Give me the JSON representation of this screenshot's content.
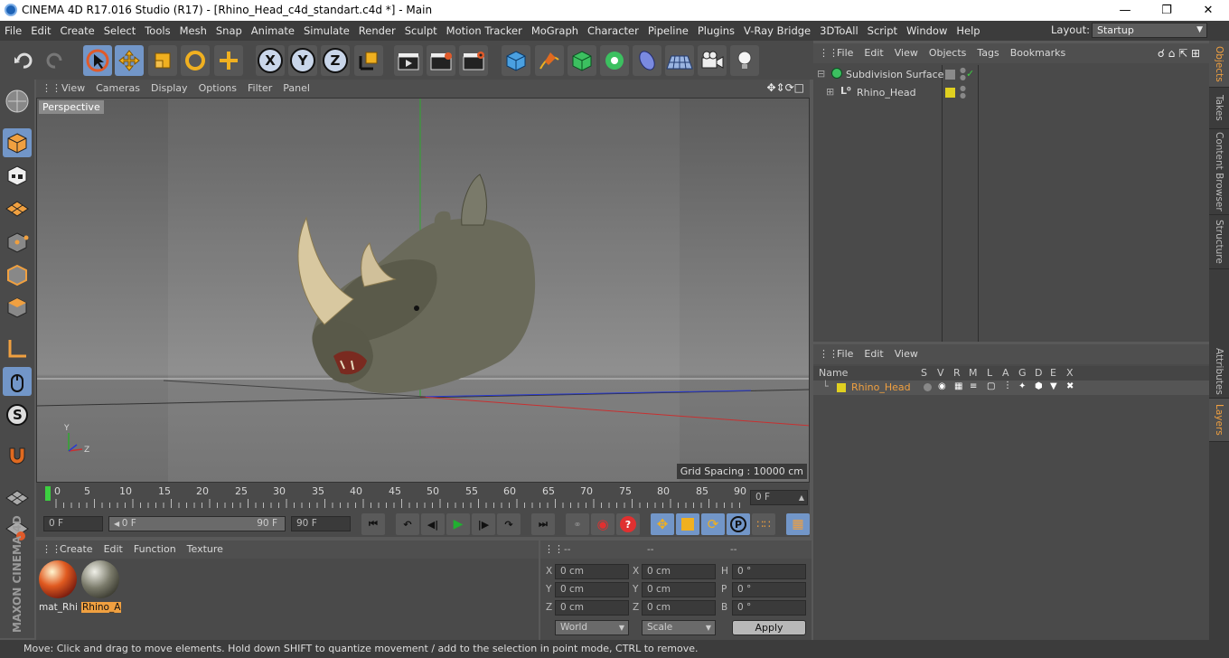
{
  "window": {
    "title": "CINEMA 4D R17.016 Studio (R17) - [Rhino_Head_c4d_standart.c4d *] - Main"
  },
  "menubar": {
    "items": [
      "File",
      "Edit",
      "Create",
      "Select",
      "Tools",
      "Mesh",
      "Snap",
      "Animate",
      "Simulate",
      "Render",
      "Sculpt",
      "Motion Tracker",
      "MoGraph",
      "Character",
      "Pipeline",
      "Plugins",
      "V-Ray Bridge",
      "3DToAll",
      "Script",
      "Window",
      "Help"
    ],
    "layout_label": "Layout:",
    "layout_value": "Startup"
  },
  "toolbar": {
    "x": "X",
    "y": "Y",
    "z": "Z"
  },
  "viewport": {
    "menu": [
      "View",
      "Cameras",
      "Display",
      "Options",
      "Filter",
      "Panel"
    ],
    "camera": "Perspective",
    "grid_spacing": "Grid Spacing : 10000 cm",
    "axis_y": "Y",
    "axis_z": "Z"
  },
  "timeline": {
    "ticks": [
      "0",
      "5",
      "10",
      "15",
      "20",
      "25",
      "30",
      "35",
      "40",
      "45",
      "50",
      "55",
      "60",
      "65",
      "70",
      "75",
      "80",
      "85",
      "90"
    ],
    "current_frame": "0 F"
  },
  "transport": {
    "start": "0 F",
    "range_start": "0 F",
    "range_end": "90 F",
    "end": "90 F"
  },
  "materials": {
    "menu": [
      "Create",
      "Edit",
      "Function",
      "Texture"
    ],
    "items": [
      {
        "name": "mat_Rhi"
      },
      {
        "name": "Rhino_A"
      }
    ]
  },
  "coordinates": {
    "header": [
      "--",
      "--",
      "--"
    ],
    "rows": [
      {
        "a": "X",
        "av": "0 cm",
        "b": "X",
        "bv": "0 cm",
        "c": "H",
        "cv": "0 °"
      },
      {
        "a": "Y",
        "av": "0 cm",
        "b": "Y",
        "bv": "0 cm",
        "c": "P",
        "cv": "0 °"
      },
      {
        "a": "Z",
        "av": "0 cm",
        "b": "Z",
        "bv": "0 cm",
        "c": "B",
        "cv": "0 °"
      }
    ],
    "world": "World",
    "scale": "Scale",
    "apply": "Apply"
  },
  "objects": {
    "menu": [
      "File",
      "Edit",
      "View",
      "Objects",
      "Tags",
      "Bookmarks"
    ],
    "items": [
      {
        "name": "Subdivision Surface"
      },
      {
        "name": "Rhino_Head"
      }
    ]
  },
  "layers": {
    "menu": [
      "File",
      "Edit",
      "View"
    ],
    "columns": [
      "Name",
      "S",
      "V",
      "R",
      "M",
      "L",
      "A",
      "G",
      "D",
      "E",
      "X"
    ],
    "items": [
      {
        "name": "Rhino_Head"
      }
    ]
  },
  "sidetabs": {
    "right": [
      "Objects",
      "Takes",
      "Content Browser",
      "Structure",
      "Attributes",
      "Layers"
    ]
  },
  "brand": {
    "text": "MAXON CINEMA 4D"
  },
  "status": {
    "text": "Move: Click and drag to move elements. Hold down SHIFT to quantize movement / add to the selection in point mode, CTRL to remove."
  },
  "colors": {
    "accent": "#7296c8",
    "selected_text": "#f0a040",
    "layer_color": "#e0d020"
  }
}
